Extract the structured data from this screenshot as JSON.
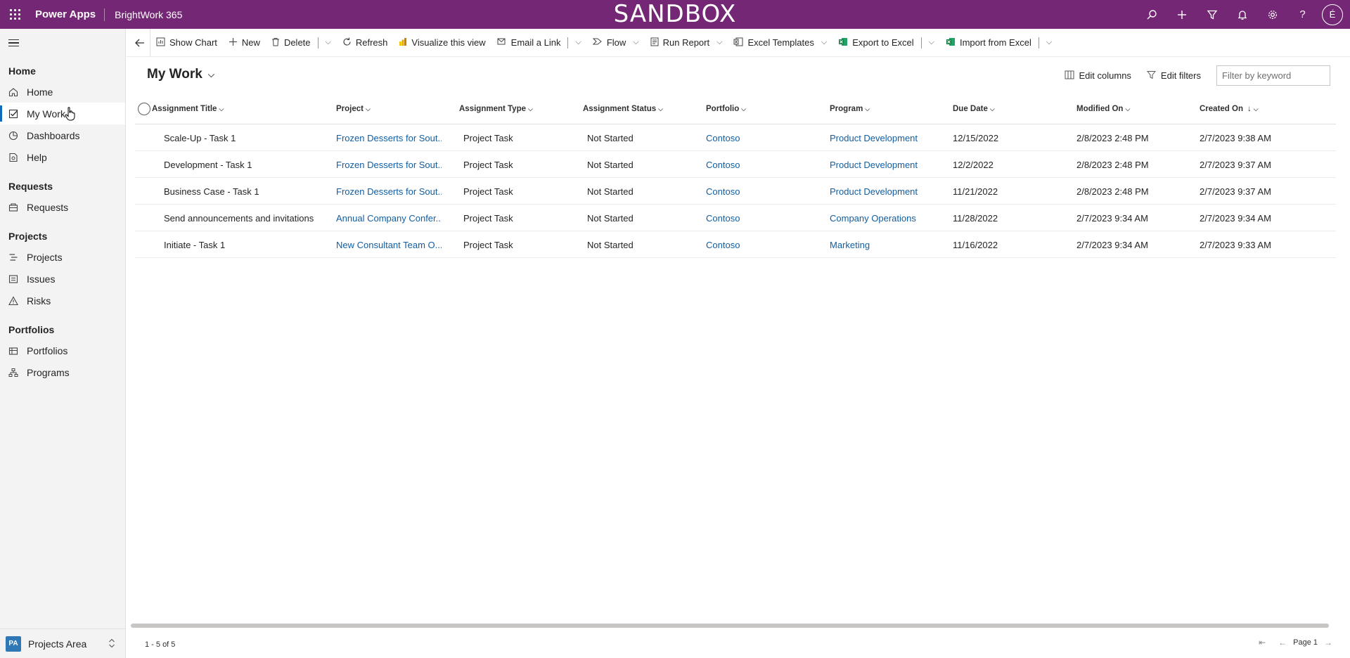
{
  "topbar": {
    "app_name": "Power Apps",
    "environment": "BrightWork 365",
    "banner": "SANDBOX",
    "avatar_initial": "É",
    "icons": [
      "search-icon",
      "plus-icon",
      "filter-icon",
      "bell-icon",
      "gear-icon",
      "help-icon"
    ],
    "color": "#742774"
  },
  "sidebar": {
    "groups": [
      {
        "label": "Home",
        "items": [
          {
            "label": "Home",
            "icon": "home-icon"
          },
          {
            "label": "My Work",
            "icon": "checkbox-icon",
            "active": true
          },
          {
            "label": "Dashboards",
            "icon": "dashboard-icon"
          },
          {
            "label": "Help",
            "icon": "help-doc-icon"
          }
        ]
      },
      {
        "label": "Requests",
        "items": [
          {
            "label": "Requests",
            "icon": "requests-icon"
          }
        ]
      },
      {
        "label": "Projects",
        "items": [
          {
            "label": "Projects",
            "icon": "projects-icon"
          },
          {
            "label": "Issues",
            "icon": "issues-icon"
          },
          {
            "label": "Risks",
            "icon": "warning-icon"
          }
        ]
      },
      {
        "label": "Portfolios",
        "items": [
          {
            "label": "Portfolios",
            "icon": "portfolio-icon"
          },
          {
            "label": "Programs",
            "icon": "programs-icon"
          }
        ]
      }
    ],
    "area": {
      "badge": "PA",
      "label": "Projects Area"
    }
  },
  "commandbar": {
    "show_chart": "Show Chart",
    "new": "New",
    "delete": "Delete",
    "refresh": "Refresh",
    "visualize": "Visualize this view",
    "email_link": "Email a Link",
    "flow": "Flow",
    "run_report": "Run Report",
    "excel_templates": "Excel Templates",
    "export_excel": "Export to Excel",
    "import_excel": "Import from Excel"
  },
  "view": {
    "title": "My Work",
    "edit_columns": "Edit columns",
    "edit_filters": "Edit filters",
    "filter_placeholder": "Filter by keyword"
  },
  "grid": {
    "columns": [
      "Assignment Title",
      "Project",
      "Assignment Type",
      "Assignment Status",
      "Portfolio",
      "Program",
      "Due Date",
      "Modified On",
      "Created On"
    ],
    "sorted_column_indicator": "↓",
    "rows": [
      [
        "Scale-Up - Task 1",
        "Frozen Desserts for Sout...",
        "Project Task",
        "Not Started",
        "Contoso",
        "Product Development",
        "12/15/2022",
        "2/8/2023 2:48 PM",
        "2/7/2023 9:38 AM"
      ],
      [
        "Development - Task 1",
        "Frozen Desserts for Sout...",
        "Project Task",
        "Not Started",
        "Contoso",
        "Product Development",
        "12/2/2022",
        "2/8/2023 2:48 PM",
        "2/7/2023 9:37 AM"
      ],
      [
        "Business Case - Task 1",
        "Frozen Desserts for Sout...",
        "Project Task",
        "Not Started",
        "Contoso",
        "Product Development",
        "11/21/2022",
        "2/8/2023 2:48 PM",
        "2/7/2023 9:37 AM"
      ],
      [
        "Send announcements and invitations",
        "Annual Company Confer...",
        "Project Task",
        "Not Started",
        "Contoso",
        "Company Operations",
        "11/28/2022",
        "2/7/2023 9:34 AM",
        "2/7/2023 9:34 AM"
      ],
      [
        "Initiate - Task 1",
        "New Consultant Team O...",
        "Project Task",
        "Not Started",
        "Contoso",
        "Marketing",
        "11/16/2022",
        "2/7/2023 9:34 AM",
        "2/7/2023 9:33 AM"
      ]
    ],
    "record_count": "1 - 5 of 5",
    "page_label": "Page 1"
  }
}
